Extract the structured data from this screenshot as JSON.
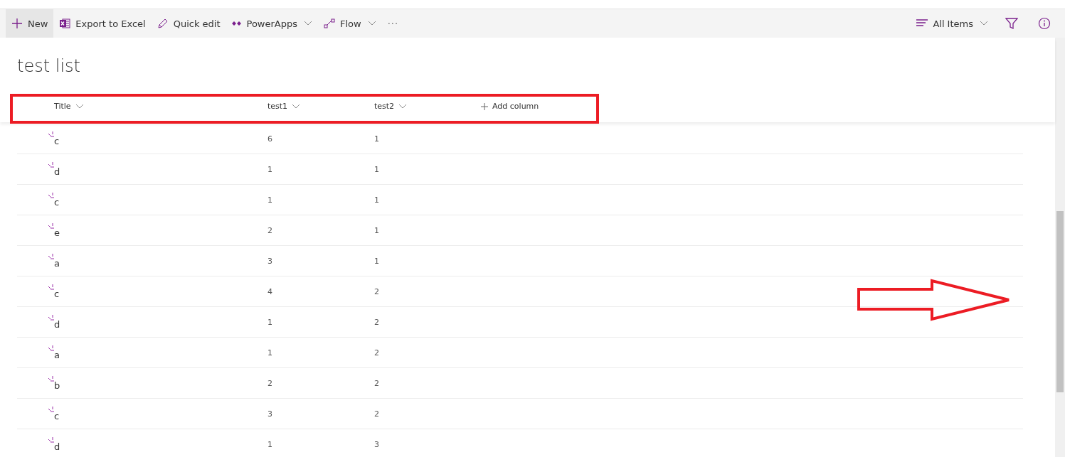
{
  "command_bar": {
    "left": [
      {
        "kind": "new",
        "label": "New"
      },
      {
        "kind": "excel",
        "label": "Export to Excel"
      },
      {
        "kind": "edit",
        "label": "Quick edit"
      },
      {
        "kind": "powerapps",
        "label": "PowerApps",
        "dropdown": true
      },
      {
        "kind": "flow",
        "label": "Flow",
        "dropdown": true
      },
      {
        "kind": "more",
        "label": "···"
      }
    ],
    "view": {
      "label": "All Items"
    }
  },
  "list_title": "test list",
  "table": {
    "columns": [
      {
        "label": "Title"
      },
      {
        "label": "test1"
      },
      {
        "label": "test2"
      }
    ],
    "add_column": "Add column",
    "rows": [
      {
        "cells": [
          "c",
          "6",
          "1"
        ]
      },
      {
        "cells": [
          "d",
          "1",
          "1"
        ]
      },
      {
        "cells": [
          "c",
          "1",
          "1"
        ]
      },
      {
        "cells": [
          "e",
          "2",
          "1"
        ]
      },
      {
        "cells": [
          "a",
          "3",
          "1"
        ]
      },
      {
        "cells": [
          "c",
          "4",
          "2"
        ]
      },
      {
        "cells": [
          "d",
          "1",
          "2"
        ]
      },
      {
        "cells": [
          "a",
          "1",
          "2"
        ]
      },
      {
        "cells": [
          "b",
          "2",
          "2"
        ]
      },
      {
        "cells": [
          "c",
          "3",
          "2"
        ]
      },
      {
        "cells": [
          "d",
          "1",
          "3"
        ]
      }
    ]
  }
}
